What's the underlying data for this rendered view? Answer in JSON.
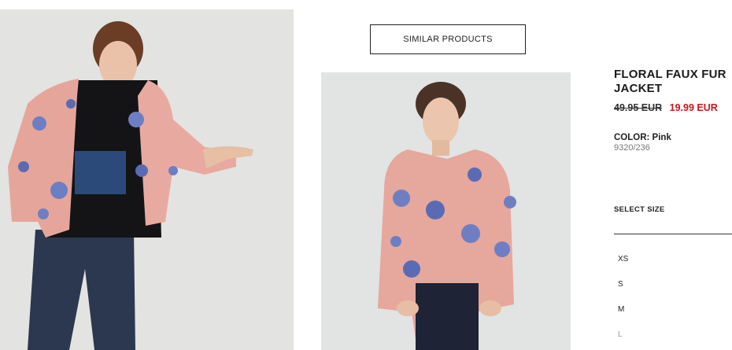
{
  "gallery": {
    "similar_label": "SIMILAR PRODUCTS"
  },
  "product": {
    "title": "FLORAL FAUX FUR JACKET",
    "price_old": "49.95 EUR",
    "price_new": "19.99 EUR",
    "color_label": "COLOR: Pink",
    "reference": "9320/236",
    "select_size_label": "SELECT SIZE",
    "sizes": [
      "XS",
      "S",
      "M",
      "L"
    ],
    "colors": {
      "sale": "#c8151e",
      "fabric": "#e7a89f",
      "flower": "#6d7fc2"
    }
  }
}
